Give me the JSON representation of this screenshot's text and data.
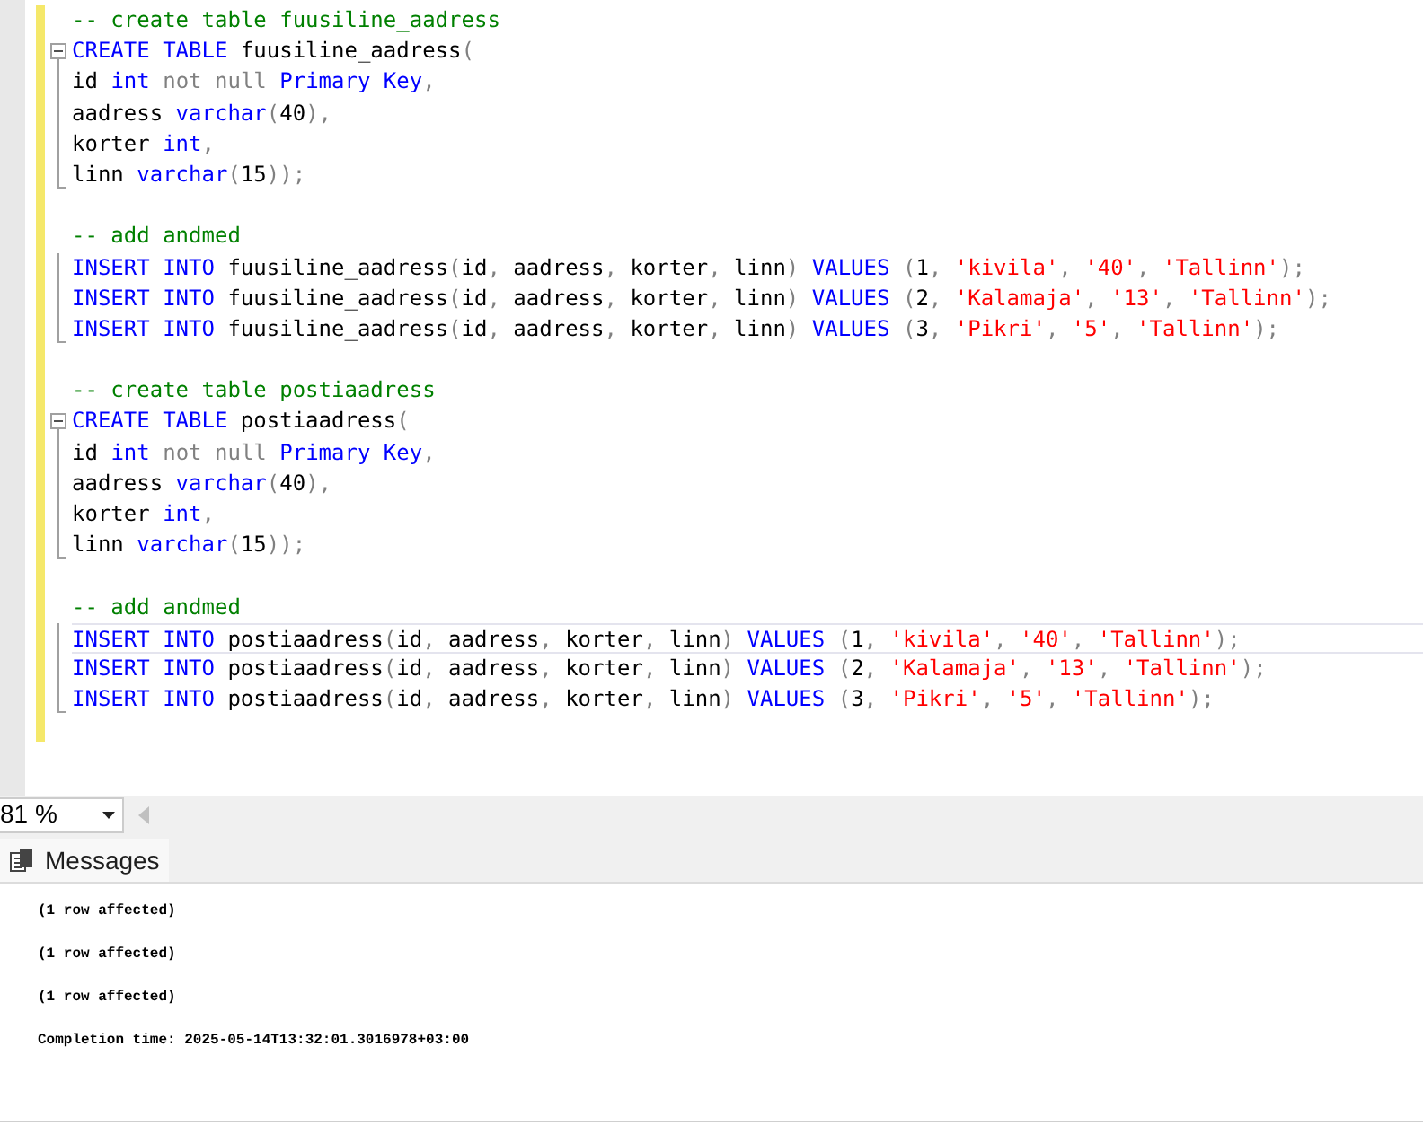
{
  "editor": {
    "lines": [
      {
        "kind": "code",
        "current": false,
        "collapsible": false,
        "in_block": false,
        "block_end": false,
        "tokens": [
          {
            "kind": "comment",
            "text": "-- create table fuusiline_aadress"
          }
        ]
      },
      {
        "kind": "code",
        "current": false,
        "collapsible": true,
        "in_block": false,
        "block_end": false,
        "tokens": [
          {
            "kind": "kw",
            "text": "CREATE TABLE "
          },
          {
            "kind": "plain",
            "text": "fuusiline_aadress"
          },
          {
            "kind": "op",
            "text": "("
          }
        ]
      },
      {
        "kind": "code",
        "current": false,
        "collapsible": false,
        "in_block": true,
        "block_end": false,
        "tokens": [
          {
            "kind": "plain",
            "text": "id "
          },
          {
            "kind": "kw",
            "text": "int "
          },
          {
            "kind": "op",
            "text": "not null "
          },
          {
            "kind": "kw",
            "text": "Primary Key"
          },
          {
            "kind": "op",
            "text": ","
          }
        ]
      },
      {
        "kind": "code",
        "current": false,
        "collapsible": false,
        "in_block": true,
        "block_end": false,
        "tokens": [
          {
            "kind": "plain",
            "text": "aadress "
          },
          {
            "kind": "kw",
            "text": "varchar"
          },
          {
            "kind": "op",
            "text": "("
          },
          {
            "kind": "plain",
            "text": "40"
          },
          {
            "kind": "op",
            "text": "),"
          }
        ]
      },
      {
        "kind": "code",
        "current": false,
        "collapsible": false,
        "in_block": true,
        "block_end": false,
        "tokens": [
          {
            "kind": "plain",
            "text": "korter "
          },
          {
            "kind": "kw",
            "text": "int"
          },
          {
            "kind": "op",
            "text": ","
          }
        ]
      },
      {
        "kind": "code",
        "current": false,
        "collapsible": false,
        "in_block": true,
        "block_end": true,
        "tokens": [
          {
            "kind": "plain",
            "text": "linn "
          },
          {
            "kind": "kw",
            "text": "varchar"
          },
          {
            "kind": "op",
            "text": "("
          },
          {
            "kind": "plain",
            "text": "15"
          },
          {
            "kind": "op",
            "text": "));"
          }
        ]
      },
      {
        "kind": "blank"
      },
      {
        "kind": "code",
        "current": false,
        "collapsible": false,
        "in_block": false,
        "block_end": false,
        "tokens": [
          {
            "kind": "comment",
            "text": "-- add andmed"
          }
        ]
      },
      {
        "kind": "code",
        "current": false,
        "collapsible": false,
        "in_block": true,
        "block_end": false,
        "tokens": [
          {
            "kind": "kw",
            "text": "INSERT INTO "
          },
          {
            "kind": "plain",
            "text": "fuusiline_aadress"
          },
          {
            "kind": "op",
            "text": "("
          },
          {
            "kind": "plain",
            "text": "id"
          },
          {
            "kind": "op",
            "text": ", "
          },
          {
            "kind": "plain",
            "text": "aadress"
          },
          {
            "kind": "op",
            "text": ", "
          },
          {
            "kind": "plain",
            "text": "korter"
          },
          {
            "kind": "op",
            "text": ", "
          },
          {
            "kind": "plain",
            "text": "linn"
          },
          {
            "kind": "op",
            "text": ") "
          },
          {
            "kind": "kw",
            "text": "VALUES "
          },
          {
            "kind": "op",
            "text": "("
          },
          {
            "kind": "plain",
            "text": "1"
          },
          {
            "kind": "op",
            "text": ", "
          },
          {
            "kind": "str",
            "text": "'kivila'"
          },
          {
            "kind": "op",
            "text": ", "
          },
          {
            "kind": "str",
            "text": "'40'"
          },
          {
            "kind": "op",
            "text": ", "
          },
          {
            "kind": "str",
            "text": "'Tallinn'"
          },
          {
            "kind": "op",
            "text": ");"
          }
        ]
      },
      {
        "kind": "code",
        "current": false,
        "collapsible": false,
        "in_block": true,
        "block_end": false,
        "tokens": [
          {
            "kind": "kw",
            "text": "INSERT INTO "
          },
          {
            "kind": "plain",
            "text": "fuusiline_aadress"
          },
          {
            "kind": "op",
            "text": "("
          },
          {
            "kind": "plain",
            "text": "id"
          },
          {
            "kind": "op",
            "text": ", "
          },
          {
            "kind": "plain",
            "text": "aadress"
          },
          {
            "kind": "op",
            "text": ", "
          },
          {
            "kind": "plain",
            "text": "korter"
          },
          {
            "kind": "op",
            "text": ", "
          },
          {
            "kind": "plain",
            "text": "linn"
          },
          {
            "kind": "op",
            "text": ") "
          },
          {
            "kind": "kw",
            "text": "VALUES "
          },
          {
            "kind": "op",
            "text": "("
          },
          {
            "kind": "plain",
            "text": "2"
          },
          {
            "kind": "op",
            "text": ", "
          },
          {
            "kind": "str",
            "text": "'Kalamaja'"
          },
          {
            "kind": "op",
            "text": ", "
          },
          {
            "kind": "str",
            "text": "'13'"
          },
          {
            "kind": "op",
            "text": ", "
          },
          {
            "kind": "str",
            "text": "'Tallinn'"
          },
          {
            "kind": "op",
            "text": ");"
          }
        ]
      },
      {
        "kind": "code",
        "current": false,
        "collapsible": false,
        "in_block": true,
        "block_end": true,
        "tokens": [
          {
            "kind": "kw",
            "text": "INSERT INTO "
          },
          {
            "kind": "plain",
            "text": "fuusiline_aadress"
          },
          {
            "kind": "op",
            "text": "("
          },
          {
            "kind": "plain",
            "text": "id"
          },
          {
            "kind": "op",
            "text": ", "
          },
          {
            "kind": "plain",
            "text": "aadress"
          },
          {
            "kind": "op",
            "text": ", "
          },
          {
            "kind": "plain",
            "text": "korter"
          },
          {
            "kind": "op",
            "text": ", "
          },
          {
            "kind": "plain",
            "text": "linn"
          },
          {
            "kind": "op",
            "text": ") "
          },
          {
            "kind": "kw",
            "text": "VALUES "
          },
          {
            "kind": "op",
            "text": "("
          },
          {
            "kind": "plain",
            "text": "3"
          },
          {
            "kind": "op",
            "text": ", "
          },
          {
            "kind": "str",
            "text": "'Pikri'"
          },
          {
            "kind": "op",
            "text": ", "
          },
          {
            "kind": "str",
            "text": "'5'"
          },
          {
            "kind": "op",
            "text": ", "
          },
          {
            "kind": "str",
            "text": "'Tallinn'"
          },
          {
            "kind": "op",
            "text": ");"
          }
        ]
      },
      {
        "kind": "blank"
      },
      {
        "kind": "code",
        "current": false,
        "collapsible": false,
        "in_block": false,
        "block_end": false,
        "tokens": [
          {
            "kind": "comment",
            "text": "-- create table postiaadress"
          }
        ]
      },
      {
        "kind": "code",
        "current": false,
        "collapsible": true,
        "in_block": false,
        "block_end": false,
        "tokens": [
          {
            "kind": "kw",
            "text": "CREATE TABLE "
          },
          {
            "kind": "plain",
            "text": "postiaadress"
          },
          {
            "kind": "op",
            "text": "("
          }
        ]
      },
      {
        "kind": "code",
        "current": false,
        "collapsible": false,
        "in_block": true,
        "block_end": false,
        "tokens": [
          {
            "kind": "plain",
            "text": "id "
          },
          {
            "kind": "kw",
            "text": "int "
          },
          {
            "kind": "op",
            "text": "not null "
          },
          {
            "kind": "kw",
            "text": "Primary Key"
          },
          {
            "kind": "op",
            "text": ","
          }
        ]
      },
      {
        "kind": "code",
        "current": false,
        "collapsible": false,
        "in_block": true,
        "block_end": false,
        "tokens": [
          {
            "kind": "plain",
            "text": "aadress "
          },
          {
            "kind": "kw",
            "text": "varchar"
          },
          {
            "kind": "op",
            "text": "("
          },
          {
            "kind": "plain",
            "text": "40"
          },
          {
            "kind": "op",
            "text": "),"
          }
        ]
      },
      {
        "kind": "code",
        "current": false,
        "collapsible": false,
        "in_block": true,
        "block_end": false,
        "tokens": [
          {
            "kind": "plain",
            "text": "korter "
          },
          {
            "kind": "kw",
            "text": "int"
          },
          {
            "kind": "op",
            "text": ","
          }
        ]
      },
      {
        "kind": "code",
        "current": false,
        "collapsible": false,
        "in_block": true,
        "block_end": true,
        "tokens": [
          {
            "kind": "plain",
            "text": "linn "
          },
          {
            "kind": "kw",
            "text": "varchar"
          },
          {
            "kind": "op",
            "text": "("
          },
          {
            "kind": "plain",
            "text": "15"
          },
          {
            "kind": "op",
            "text": "));"
          }
        ]
      },
      {
        "kind": "blank"
      },
      {
        "kind": "code",
        "current": false,
        "collapsible": false,
        "in_block": false,
        "block_end": false,
        "tokens": [
          {
            "kind": "comment",
            "text": "-- add andmed"
          }
        ]
      },
      {
        "kind": "code",
        "current": true,
        "collapsible": false,
        "in_block": true,
        "block_end": false,
        "tokens": [
          {
            "kind": "kw",
            "text": "INSERT INTO "
          },
          {
            "kind": "plain",
            "text": "postiaadress"
          },
          {
            "kind": "op",
            "text": "("
          },
          {
            "kind": "plain",
            "text": "id"
          },
          {
            "kind": "op",
            "text": ", "
          },
          {
            "kind": "plain",
            "text": "aadress"
          },
          {
            "kind": "op",
            "text": ", "
          },
          {
            "kind": "plain",
            "text": "korter"
          },
          {
            "kind": "op",
            "text": ", "
          },
          {
            "kind": "plain",
            "text": "linn"
          },
          {
            "kind": "op",
            "text": ") "
          },
          {
            "kind": "kw",
            "text": "VALUES "
          },
          {
            "kind": "op",
            "text": "("
          },
          {
            "kind": "plain",
            "text": "1"
          },
          {
            "kind": "op",
            "text": ", "
          },
          {
            "kind": "str",
            "text": "'kivila'"
          },
          {
            "kind": "op",
            "text": ", "
          },
          {
            "kind": "str",
            "text": "'40'"
          },
          {
            "kind": "op",
            "text": ", "
          },
          {
            "kind": "str",
            "text": "'Tallinn'"
          },
          {
            "kind": "op",
            "text": ");"
          }
        ]
      },
      {
        "kind": "code",
        "current": false,
        "collapsible": false,
        "in_block": true,
        "block_end": false,
        "tokens": [
          {
            "kind": "kw",
            "text": "INSERT INTO "
          },
          {
            "kind": "plain",
            "text": "postiaadress"
          },
          {
            "kind": "op",
            "text": "("
          },
          {
            "kind": "plain",
            "text": "id"
          },
          {
            "kind": "op",
            "text": ", "
          },
          {
            "kind": "plain",
            "text": "aadress"
          },
          {
            "kind": "op",
            "text": ", "
          },
          {
            "kind": "plain",
            "text": "korter"
          },
          {
            "kind": "op",
            "text": ", "
          },
          {
            "kind": "plain",
            "text": "linn"
          },
          {
            "kind": "op",
            "text": ") "
          },
          {
            "kind": "kw",
            "text": "VALUES "
          },
          {
            "kind": "op",
            "text": "("
          },
          {
            "kind": "plain",
            "text": "2"
          },
          {
            "kind": "op",
            "text": ", "
          },
          {
            "kind": "str",
            "text": "'Kalamaja'"
          },
          {
            "kind": "op",
            "text": ", "
          },
          {
            "kind": "str",
            "text": "'13'"
          },
          {
            "kind": "op",
            "text": ", "
          },
          {
            "kind": "str",
            "text": "'Tallinn'"
          },
          {
            "kind": "op",
            "text": ");"
          }
        ]
      },
      {
        "kind": "code",
        "current": false,
        "collapsible": false,
        "in_block": true,
        "block_end": true,
        "tokens": [
          {
            "kind": "kw",
            "text": "INSERT INTO "
          },
          {
            "kind": "plain",
            "text": "postiaadress"
          },
          {
            "kind": "op",
            "text": "("
          },
          {
            "kind": "plain",
            "text": "id"
          },
          {
            "kind": "op",
            "text": ", "
          },
          {
            "kind": "plain",
            "text": "aadress"
          },
          {
            "kind": "op",
            "text": ", "
          },
          {
            "kind": "plain",
            "text": "korter"
          },
          {
            "kind": "op",
            "text": ", "
          },
          {
            "kind": "plain",
            "text": "linn"
          },
          {
            "kind": "op",
            "text": ") "
          },
          {
            "kind": "kw",
            "text": "VALUES "
          },
          {
            "kind": "op",
            "text": "("
          },
          {
            "kind": "plain",
            "text": "3"
          },
          {
            "kind": "op",
            "text": ", "
          },
          {
            "kind": "str",
            "text": "'Pikri'"
          },
          {
            "kind": "op",
            "text": ", "
          },
          {
            "kind": "str",
            "text": "'5'"
          },
          {
            "kind": "op",
            "text": ", "
          },
          {
            "kind": "str",
            "text": "'Tallinn'"
          },
          {
            "kind": "op",
            "text": ");"
          }
        ]
      }
    ]
  },
  "zoom": {
    "value": "81 %"
  },
  "tabs": [
    {
      "label": "Messages",
      "selected": true
    }
  ],
  "messages": [
    "(1 row affected)",
    "(1 row affected)",
    "(1 row affected)",
    "Completion time: 2025-05-14T13:32:01.3016978+03:00"
  ]
}
